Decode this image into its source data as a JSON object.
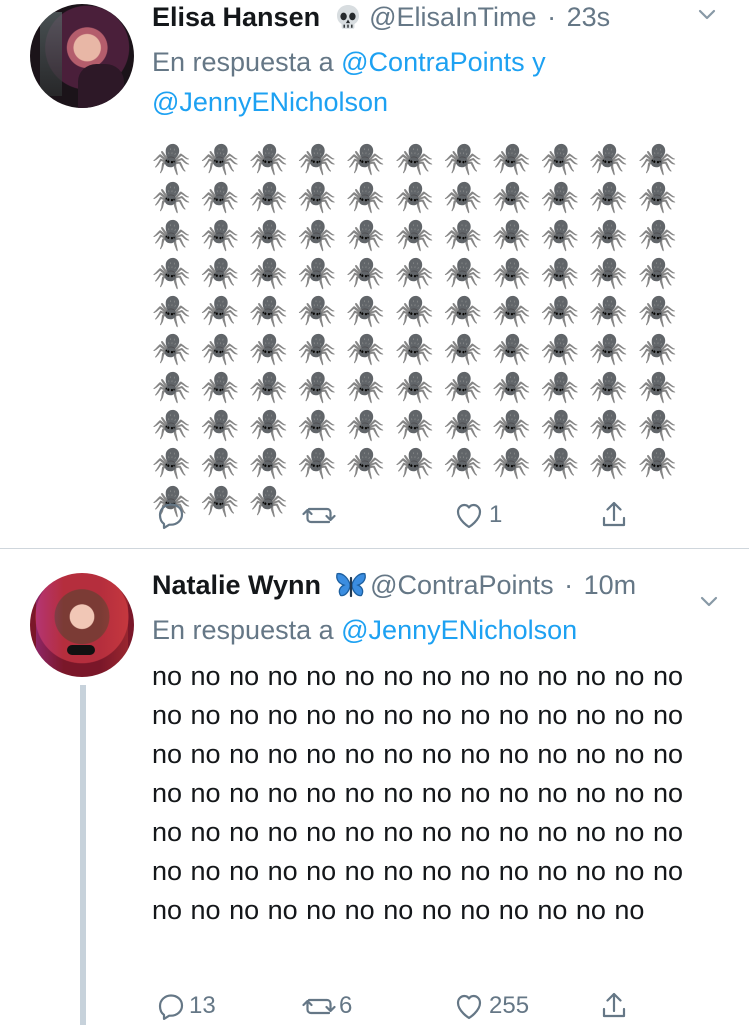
{
  "tweets": [
    {
      "author_name": "Elisa Hansen",
      "author_emoji": "skull-icon",
      "handle": "@ElisaInTime",
      "separator": "·",
      "time": "23s",
      "reply_prefix": "En respuesta a",
      "reply_mentions": [
        "@ContraPoints",
        "@JennyENicholson"
      ],
      "reply_joiner": "y",
      "body": "🕷️🕷️🕷️🕷️🕷️🕷️🕷️🕷️🕷️🕷️🕷️🕷️🕷️🕷️🕷️🕷️🕷️🕷️🕷️🕷️🕷️🕷️🕷️🕷️🕷️🕷️🕷️🕷️🕷️🕷️🕷️🕷️🕷️🕷️🕷️🕷️🕷️🕷️🕷️🕷️🕷️🕷️🕷️🕷️🕷️🕷️🕷️🕷️🕷️🕷️🕷️🕷️🕷️🕷️🕷️🕷️🕷️🕷️🕷️🕷️🕷️🕷️🕷️🕷️🕷️🕷️🕷️🕷️🕷️🕷️🕷️🕷️🕷️🕷️🕷️🕷️🕷️🕷️🕷️🕷️🕷️🕷️🕷️🕷️🕷️🕷️🕷️🕷️🕷️🕷️🕷️🕷️🕷️🕷️🕷️🕷️🕷️🕷️🕷️🕷️🕷️🕷️",
      "counts": {
        "reply": "",
        "retweet": "",
        "like": "1"
      }
    },
    {
      "author_name": "Natalie Wynn",
      "author_emoji": "butterfly-icon",
      "handle": "@ContraPoints",
      "separator": "·",
      "time": "10m",
      "reply_prefix": "En respuesta a",
      "reply_mentions": [
        "@JennyENicholson"
      ],
      "body": "no no no no no no no no no no no no no no no no no no no no no no no no no no no no no no no no no no no no no no no no no no no no no no no no no no no no no no no no no no no no no no no no no no no no no no no no no no no no no no no no no no no no no no no no no no no no no no no no no",
      "counts": {
        "reply": "13",
        "retweet": "6",
        "like": "255"
      }
    }
  ],
  "icons": {
    "reply": "reply-icon",
    "retweet": "retweet-icon",
    "like": "heart-icon",
    "share": "share-icon",
    "more": "chevron-down-icon"
  },
  "colors": {
    "text": "#14171a",
    "secondary": "#657786",
    "link": "#1da1f2",
    "divider": "#cfd6dc",
    "thread": "#c7d2db"
  }
}
